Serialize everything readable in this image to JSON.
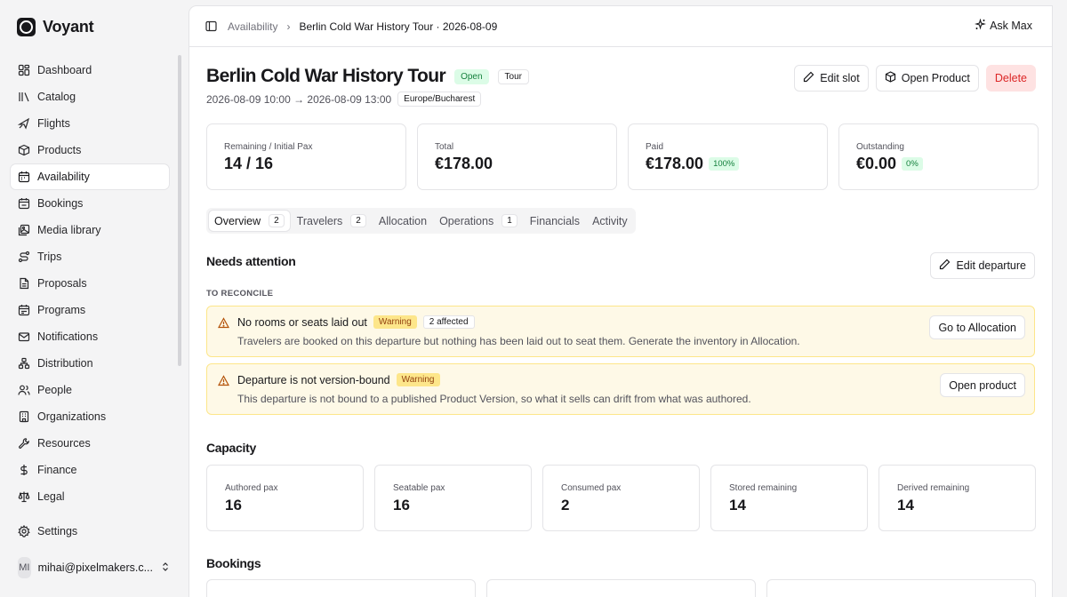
{
  "brand": {
    "name": "Voyant"
  },
  "sidebar": {
    "items": [
      {
        "label": "Dashboard",
        "icon": "dashboard-icon"
      },
      {
        "label": "Catalog",
        "icon": "catalog-icon"
      },
      {
        "label": "Flights",
        "icon": "plane-icon"
      },
      {
        "label": "Products",
        "icon": "package-icon"
      },
      {
        "label": "Availability",
        "icon": "calendar-icon",
        "active": true
      },
      {
        "label": "Bookings",
        "icon": "calendar-check-icon"
      },
      {
        "label": "Media library",
        "icon": "image-icon"
      },
      {
        "label": "Trips",
        "icon": "route-icon"
      },
      {
        "label": "Proposals",
        "icon": "document-icon"
      },
      {
        "label": "Programs",
        "icon": "calendar-range-icon"
      },
      {
        "label": "Notifications",
        "icon": "mail-icon"
      },
      {
        "label": "Distribution",
        "icon": "network-icon"
      },
      {
        "label": "People",
        "icon": "users-icon"
      },
      {
        "label": "Organizations",
        "icon": "building-icon"
      },
      {
        "label": "Resources",
        "icon": "wrench-icon"
      },
      {
        "label": "Finance",
        "icon": "dollar-icon"
      },
      {
        "label": "Legal",
        "icon": "scale-icon"
      }
    ],
    "settings_label": "Settings",
    "user": {
      "initials": "MI",
      "email": "mihai@pixelmakers.c..."
    }
  },
  "topbar": {
    "breadcrumb_parent": "Availability",
    "breadcrumb_current": "Berlin Cold War History Tour · 2026-08-09",
    "ask_label": "Ask Max"
  },
  "header": {
    "title": "Berlin Cold War History Tour",
    "status": "Open",
    "type": "Tour",
    "date_range": "2026-08-09 10:00 → 2026-08-09 13:00",
    "timezone": "Europe/Bucharest",
    "edit_slot": "Edit slot",
    "open_product": "Open Product",
    "delete": "Delete"
  },
  "stats": [
    {
      "label": "Remaining / Initial Pax",
      "value": "14 / 16",
      "pct": ""
    },
    {
      "label": "Total",
      "value": "€178.00",
      "pct": ""
    },
    {
      "label": "Paid",
      "value": "€178.00",
      "pct": "100%"
    },
    {
      "label": "Outstanding",
      "value": "€0.00",
      "pct": "0%"
    }
  ],
  "tabs": [
    {
      "label": "Overview",
      "count": "2",
      "active": true
    },
    {
      "label": "Travelers",
      "count": "2"
    },
    {
      "label": "Allocation",
      "count": ""
    },
    {
      "label": "Operations",
      "count": "1"
    },
    {
      "label": "Financials",
      "count": ""
    },
    {
      "label": "Activity",
      "count": ""
    }
  ],
  "attention": {
    "title": "Needs attention",
    "edit_label": "Edit departure",
    "section_label": "TO RECONCILE",
    "alerts": [
      {
        "title": "No rooms or seats laid out",
        "level": "Warning",
        "affected": "2 affected",
        "desc": "Travelers are booked on this departure but nothing has been laid out to seat them. Generate the inventory in Allocation.",
        "action": "Go to Allocation"
      },
      {
        "title": "Departure is not version-bound",
        "level": "Warning",
        "affected": "",
        "desc": "This departure is not bound to a published Product Version, so what it sells can drift from what was authored.",
        "action": "Open product"
      }
    ]
  },
  "capacity": {
    "title": "Capacity",
    "items": [
      {
        "label": "Authored pax",
        "value": "16"
      },
      {
        "label": "Seatable pax",
        "value": "16"
      },
      {
        "label": "Consumed pax",
        "value": "2"
      },
      {
        "label": "Stored remaining",
        "value": "14"
      },
      {
        "label": "Derived remaining",
        "value": "14"
      }
    ]
  },
  "bookings": {
    "title": "Bookings"
  }
}
